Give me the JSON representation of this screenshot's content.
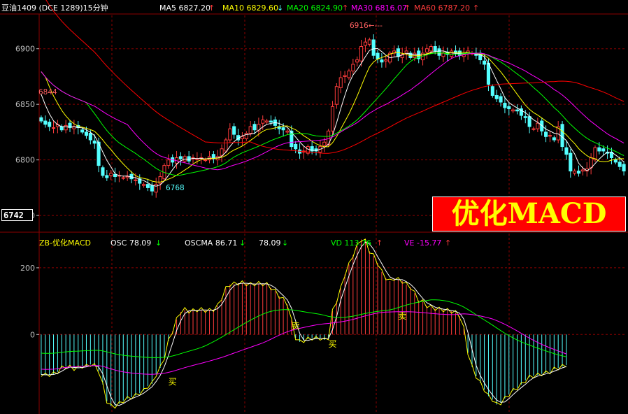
{
  "header": {
    "instrument": "豆油1409 (DCE  1289)15分钟",
    "ma5": "MA5 6827.20",
    "ma10": "MA10 6829.60",
    "ma20": "MA20 6824.90",
    "ma30": "MA30 6816.07",
    "ma60": "MA60  6787.20",
    "ma5_arrow": "↑",
    "ma10_arrow": "↓",
    "ma20_arrow": "↑",
    "ma30_arrow": "↑",
    "ma60_arrow": "↑"
  },
  "current_price_box": "6742",
  "price_annotations": {
    "high_label": "6916←---",
    "low_label": "6768",
    "left_label": "6844"
  },
  "banner_text": "优化MACD",
  "lower_header": {
    "name": "ZB-优化MACD",
    "osc": "OSC  78.09",
    "oscma": "OSCMA  86.71",
    "oscma2": "78.09",
    "vd": "VD   113.76",
    "ve": "VE  -15.77",
    "osc_arrow": "↓",
    "oscma_arrow": "↓",
    "oscma2_arrow": "↓",
    "vd_arrow": "↑",
    "ve_arrow": "↑"
  },
  "signals": [
    {
      "label": "卖",
      "index": 62
    },
    {
      "label": "买",
      "index": 71
    },
    {
      "label": "卖",
      "index": 88
    },
    {
      "label": "买",
      "index": 32
    }
  ],
  "colors": {
    "background": "#000000",
    "grid": "#8b0000",
    "axis_text": "#c0c0c0",
    "up": "#ff3c3c",
    "down": "#54ffff",
    "ma5": "#ffffff",
    "ma10": "#ffff00",
    "ma20": "#00ff00",
    "ma30": "#ff00ff",
    "ma60": "#ff0000",
    "banner_bg": "#ff0000",
    "banner_text": "#ffff00"
  },
  "chart_data": [
    {
      "type": "candlestick",
      "title": "豆油1409 (DCE 1289)15分钟",
      "y_ticks": [
        6750,
        6800,
        6850,
        6900
      ],
      "ylim": [
        6735,
        6930
      ],
      "closes": [
        6835,
        6832,
        6830,
        6829,
        6832,
        6827,
        6831,
        6829,
        6830,
        6829,
        6825,
        6822,
        6818,
        6815,
        6795,
        6786,
        6784,
        6788,
        6785,
        6786,
        6784,
        6785,
        6783,
        6782,
        6779,
        6778,
        6775,
        6772,
        6778,
        6785,
        6795,
        6800,
        6798,
        6802,
        6801,
        6803,
        6799,
        6802,
        6801,
        6802,
        6800,
        6803,
        6801,
        6803,
        6810,
        6818,
        6828,
        6823,
        6818,
        6821,
        6824,
        6830,
        6827,
        6832,
        6836,
        6835,
        6834,
        6831,
        6828,
        6827,
        6826,
        6812,
        6810,
        6806,
        6808,
        6812,
        6808,
        6808,
        6812,
        6816,
        6826,
        6848,
        6866,
        6874,
        6876,
        6880,
        6886,
        6890,
        6902,
        6906,
        6908,
        6894,
        6891,
        6888,
        6890,
        6896,
        6898,
        6893,
        6895,
        6898,
        6892,
        6896,
        6891,
        6896,
        6900,
        6902,
        6898,
        6894,
        6896,
        6895,
        6898,
        6896,
        6894,
        6895,
        6898,
        6896,
        6894,
        6890,
        6886,
        6868,
        6858,
        6855,
        6852,
        6847,
        6846,
        6845,
        6844,
        6840,
        6838,
        6830,
        6828,
        6833,
        6826,
        6821,
        6822,
        6818,
        6830,
        6812,
        6805,
        6790,
        6790,
        6788,
        6791,
        6792,
        6802,
        6811,
        6808,
        6808,
        6806,
        6802,
        6798,
        6794,
        6790
      ]
    },
    {
      "type": "bar",
      "title": "ZB-优化MACD",
      "y_ticks": [
        0,
        200
      ],
      "ylim": [
        -230,
        290
      ],
      "values": [
        -120,
        -122,
        -120,
        -118,
        -112,
        -100,
        -96,
        -98,
        -102,
        -100,
        -95,
        -96,
        -90,
        -93,
        -110,
        -150,
        -200,
        -215,
        -215,
        -208,
        -198,
        -192,
        -188,
        -183,
        -176,
        -168,
        -155,
        -148,
        -120,
        -100,
        -70,
        -20,
        10,
        45,
        68,
        75,
        70,
        71,
        74,
        75,
        72,
        72,
        75,
        86,
        110,
        138,
        150,
        152,
        154,
        155,
        152,
        150,
        152,
        153,
        152,
        150,
        140,
        130,
        115,
        105,
        90,
        42,
        -10,
        -22,
        -18,
        -14,
        -11,
        -12,
        -11,
        -16,
        -10,
        70,
        101,
        138,
        180,
        210,
        238,
        266,
        285,
        280,
        250,
        236,
        214,
        188,
        170,
        160,
        168,
        165,
        160,
        150,
        142,
        124,
        102,
        98,
        86,
        82,
        78,
        76,
        74,
        72,
        70,
        66,
        55,
        18,
        -55,
        -97,
        -125,
        -145,
        -165,
        -185,
        -195,
        -210,
        -205,
        -192,
        -180,
        -168,
        -160,
        -150,
        -138,
        -128,
        -124,
        -122,
        -118,
        -115,
        -112,
        -104,
        -100,
        -96,
        -92
      ],
      "series": [
        {
          "name": "OSC",
          "color": "#ffff00"
        },
        {
          "name": "OSCMA",
          "color": "#ffffff"
        },
        {
          "name": "VD",
          "color": "#00ff00"
        },
        {
          "name": "VE",
          "color": "#ff00ff"
        }
      ]
    }
  ]
}
